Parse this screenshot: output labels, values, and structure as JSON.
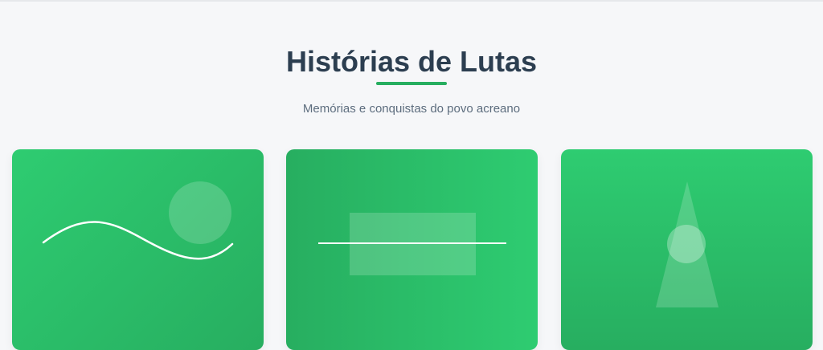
{
  "section": {
    "title": "Histórias de Lutas",
    "subtitle": "Memórias e conquistas do povo acreano"
  },
  "cards": [
    {
      "illustration": "wave-and-sun-illustration"
    },
    {
      "illustration": "rectangle-and-line-illustration"
    },
    {
      "illustration": "cone-and-circle-illustration"
    }
  ],
  "colors": {
    "background": "#f6f7f9",
    "title": "#2c3e50",
    "subtitle": "#5d6d7e",
    "accent": "#27ae60",
    "card_light": "#2ecc71",
    "card_dark": "#27ae60"
  }
}
